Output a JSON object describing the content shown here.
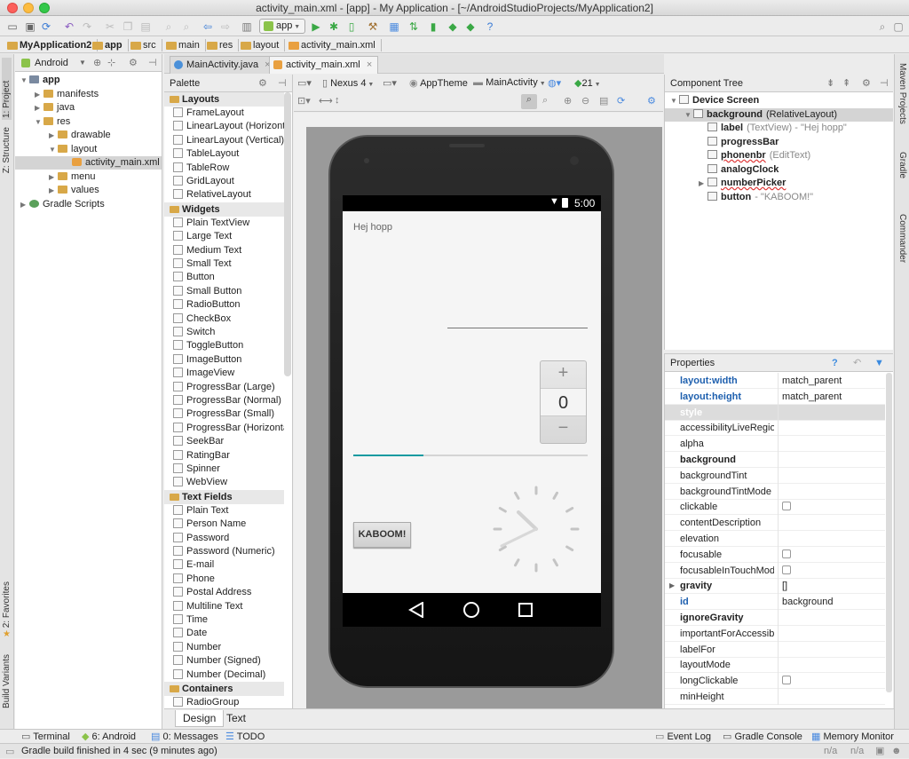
{
  "window": {
    "title": "activity_main.xml - [app] - My Application - [~/AndroidStudioProjects/MyApplication2]"
  },
  "toolbar": {
    "run_config": "app"
  },
  "breadcrumbs": [
    "MyApplication2",
    "app",
    "src",
    "main",
    "res",
    "layout",
    "activity_main.xml"
  ],
  "left_strip": {
    "project": "1: Project",
    "structure": "Z: Structure",
    "favorites": "2: Favorites",
    "build_variants": "Build Variants"
  },
  "right_strip": {
    "maven": "Maven Projects",
    "gradle": "Gradle",
    "commander": "Commander"
  },
  "project_panel": {
    "view_mode": "Android",
    "tree": [
      {
        "label": "app",
        "bold": true,
        "level": 0,
        "expanded": true,
        "kind": "module"
      },
      {
        "label": "manifests",
        "level": 1,
        "expanded": false,
        "kind": "folder"
      },
      {
        "label": "java",
        "level": 1,
        "expanded": false,
        "kind": "folder"
      },
      {
        "label": "res",
        "level": 1,
        "expanded": true,
        "kind": "folder"
      },
      {
        "label": "drawable",
        "level": 2,
        "expanded": false,
        "kind": "folder"
      },
      {
        "label": "layout",
        "level": 2,
        "expanded": true,
        "kind": "folder"
      },
      {
        "label": "activity_main.xml",
        "level": 3,
        "selected": true,
        "kind": "xml"
      },
      {
        "label": "menu",
        "level": 2,
        "expanded": false,
        "kind": "folder"
      },
      {
        "label": "values",
        "level": 2,
        "expanded": false,
        "kind": "folder"
      },
      {
        "label": "Gradle Scripts",
        "level": 0,
        "expanded": false,
        "kind": "gradle"
      }
    ]
  },
  "editor_tabs": [
    {
      "label": "MainActivity.java",
      "active": false
    },
    {
      "label": "activity_main.xml",
      "active": true
    }
  ],
  "palette": {
    "title": "Palette",
    "sections": [
      {
        "name": "Layouts",
        "items": [
          "FrameLayout",
          "LinearLayout (Horizonta",
          "LinearLayout (Vertical)",
          "TableLayout",
          "TableRow",
          "GridLayout",
          "RelativeLayout"
        ]
      },
      {
        "name": "Widgets",
        "items": [
          "Plain TextView",
          "Large Text",
          "Medium Text",
          "Small Text",
          "Button",
          "Small Button",
          "RadioButton",
          "CheckBox",
          "Switch",
          "ToggleButton",
          "ImageButton",
          "ImageView",
          "ProgressBar (Large)",
          "ProgressBar (Normal)",
          "ProgressBar (Small)",
          "ProgressBar (Horizonta",
          "SeekBar",
          "RatingBar",
          "Spinner",
          "WebView"
        ]
      },
      {
        "name": "Text Fields",
        "items": [
          "Plain Text",
          "Person Name",
          "Password",
          "Password (Numeric)",
          "E-mail",
          "Phone",
          "Postal Address",
          "Multiline Text",
          "Time",
          "Date",
          "Number",
          "Number (Signed)",
          "Number (Decimal)"
        ]
      },
      {
        "name": "Containers",
        "items": [
          "RadioGroup"
        ]
      }
    ]
  },
  "designbar": {
    "device": "Nexus 4",
    "theme": "AppTheme",
    "activity": "MainActivity",
    "api": "21"
  },
  "preview": {
    "time": "5:00",
    "label_text": "Hej hopp",
    "picker_plus": "+",
    "picker_value": "0",
    "picker_minus": "−",
    "button_text": "KABOOM!",
    "progress": 0.3
  },
  "bottom_tabs": {
    "design": "Design",
    "text": "Text"
  },
  "component_tree": {
    "title": "Component Tree",
    "rows": [
      {
        "name": "Device Screen",
        "suffix": "",
        "level": 0
      },
      {
        "name": "background",
        "suffix": "(RelativeLayout)",
        "level": 1,
        "selected": true
      },
      {
        "name": "label",
        "suffix": "(TextView) - \"Hej hopp\"",
        "level": 2
      },
      {
        "name": "progressBar",
        "suffix": "",
        "level": 2
      },
      {
        "name": "phonenbr",
        "suffix": "(EditText)",
        "level": 2,
        "error": true
      },
      {
        "name": "analogClock",
        "suffix": "",
        "level": 2
      },
      {
        "name": "numberPicker",
        "suffix": "",
        "level": 2,
        "error": true,
        "collapsed": true
      },
      {
        "name": "button",
        "suffix": "- \"KABOOM!\"",
        "level": 2
      }
    ]
  },
  "properties": {
    "title": "Properties",
    "rows": [
      {
        "name": "layout:width",
        "value": "match_parent",
        "style": "link"
      },
      {
        "name": "layout:height",
        "value": "match_parent",
        "style": "link"
      },
      {
        "name": "style",
        "value": "",
        "style": "section"
      },
      {
        "name": "accessibilityLiveRegion",
        "value": ""
      },
      {
        "name": "alpha",
        "value": ""
      },
      {
        "name": "background",
        "value": "",
        "style": "bold"
      },
      {
        "name": "backgroundTint",
        "value": ""
      },
      {
        "name": "backgroundTintMode",
        "value": ""
      },
      {
        "name": "clickable",
        "value": "",
        "checkbox": true
      },
      {
        "name": "contentDescription",
        "value": ""
      },
      {
        "name": "elevation",
        "value": ""
      },
      {
        "name": "focusable",
        "value": "",
        "checkbox": true
      },
      {
        "name": "focusableInTouchMode",
        "value": "",
        "checkbox": true
      },
      {
        "name": "gravity",
        "value": "[]",
        "style": "bold",
        "expand": true
      },
      {
        "name": "id",
        "value": "background",
        "style": "link"
      },
      {
        "name": "ignoreGravity",
        "value": "",
        "style": "bold"
      },
      {
        "name": "importantForAccessibil",
        "value": ""
      },
      {
        "name": "labelFor",
        "value": ""
      },
      {
        "name": "layoutMode",
        "value": ""
      },
      {
        "name": "longClickable",
        "value": "",
        "checkbox": true
      },
      {
        "name": "minHeight",
        "value": ""
      }
    ]
  },
  "tool_windows": {
    "terminal": "Terminal",
    "android": "6: Android",
    "messages": "0: Messages",
    "todo": "TODO",
    "event_log": "Event Log",
    "gradle_console": "Gradle Console",
    "memory_monitor": "Memory Monitor"
  },
  "status": {
    "message": "Gradle build finished in 4 sec (9 minutes ago)",
    "na1": "n/a",
    "na2": "n/a"
  },
  "colors": {
    "accent": "#1d5fae",
    "teal": "#159aa0",
    "selection": "#d4d4d4"
  }
}
